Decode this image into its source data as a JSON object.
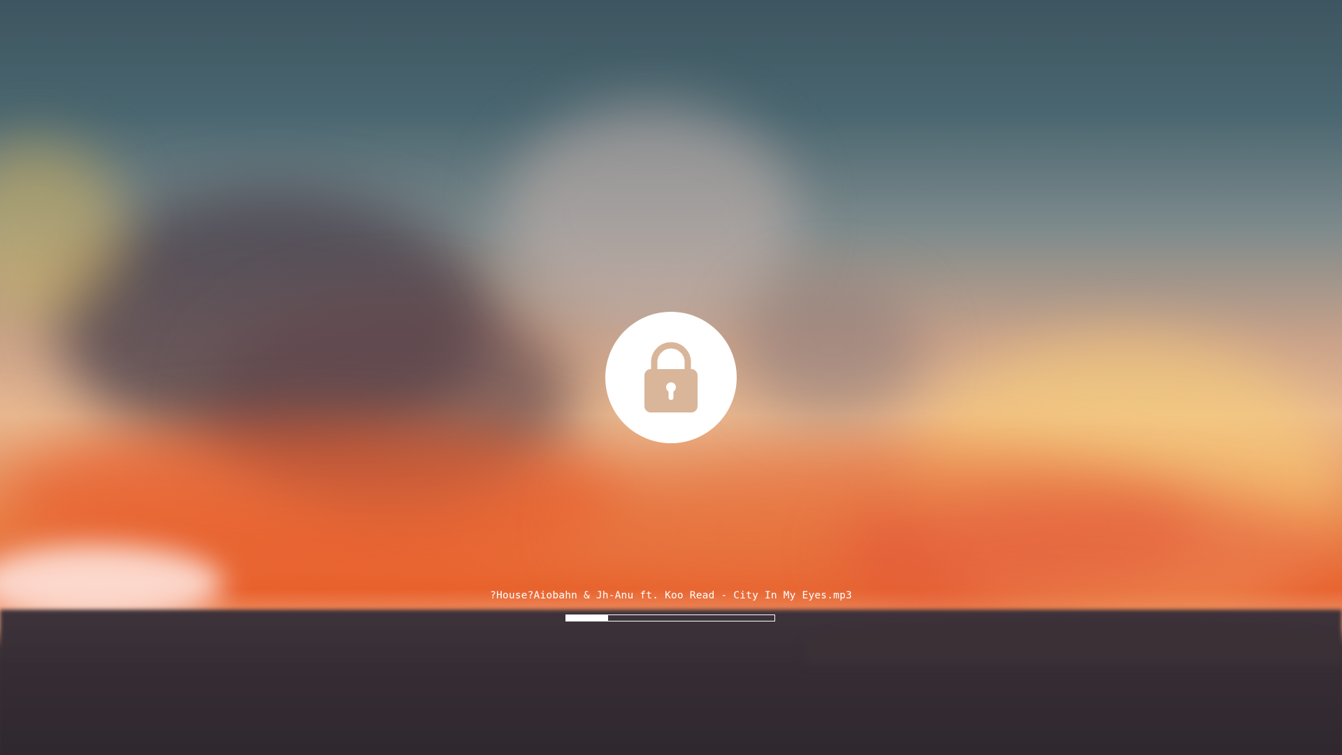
{
  "screen": {
    "type": "lock-screen"
  },
  "lock": {
    "icon": "padlock-icon",
    "circle_color": "#ffffff",
    "icon_color": "#d9b59a"
  },
  "media": {
    "track_title": "?House?Aiobahn & Jh-Anu ft. Koo Read - City In My Eyes.mp3",
    "progress_percent": 20
  }
}
